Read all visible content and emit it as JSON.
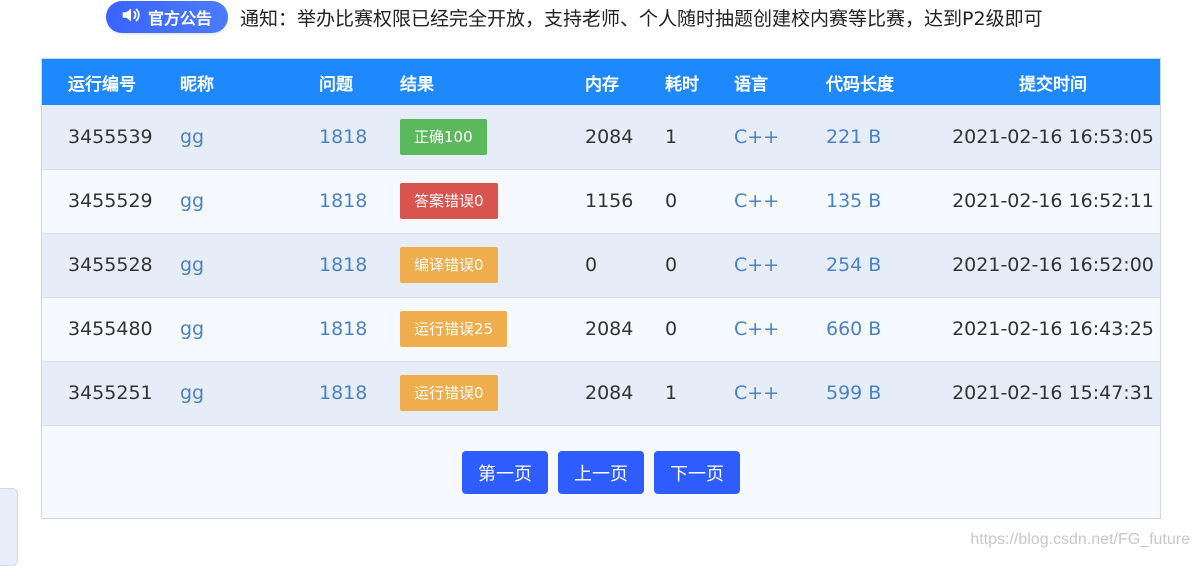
{
  "notice": {
    "badge_label": "官方公告",
    "text": "通知：举办比赛权限已经完全开放，支持老师、个人随时抽题创建校内赛等比赛，达到P2级即可"
  },
  "table": {
    "headers": [
      "运行编号",
      "昵称",
      "问题",
      "结果",
      "内存",
      "耗时",
      "语言",
      "代码长度",
      "提交时间"
    ],
    "rows": [
      {
        "id": "3455539",
        "nick": "gg",
        "problem": "1818",
        "result": "正确100",
        "result_color": "#5cb85c",
        "memory": "2084",
        "time": "1",
        "lang": "C++",
        "length": "221 B",
        "submitted": "2021-02-16 16:53:05"
      },
      {
        "id": "3455529",
        "nick": "gg",
        "problem": "1818",
        "result": "答案错误0",
        "result_color": "#d9534f",
        "memory": "1156",
        "time": "0",
        "lang": "C++",
        "length": "135 B",
        "submitted": "2021-02-16 16:52:11"
      },
      {
        "id": "3455528",
        "nick": "gg",
        "problem": "1818",
        "result": "编译错误0",
        "result_color": "#f0ad4e",
        "memory": "0",
        "time": "0",
        "lang": "C++",
        "length": "254 B",
        "submitted": "2021-02-16 16:52:00"
      },
      {
        "id": "3455480",
        "nick": "gg",
        "problem": "1818",
        "result": "运行错误25",
        "result_color": "#f0ad4e",
        "memory": "2084",
        "time": "0",
        "lang": "C++",
        "length": "660 B",
        "submitted": "2021-02-16 16:43:25"
      },
      {
        "id": "3455251",
        "nick": "gg",
        "problem": "1818",
        "result": "运行错误0",
        "result_color": "#f0ad4e",
        "memory": "2084",
        "time": "1",
        "lang": "C++",
        "length": "599 B",
        "submitted": "2021-02-16 15:47:31"
      }
    ]
  },
  "pager": {
    "first": "第一页",
    "prev": "上一页",
    "next": "下一页"
  },
  "watermark": "https://blog.csdn.net/FG_future",
  "icons": {
    "badge": "speaker-icon"
  },
  "colors": {
    "header_bg": "#1e88ff",
    "accent": "#2f5cff"
  }
}
